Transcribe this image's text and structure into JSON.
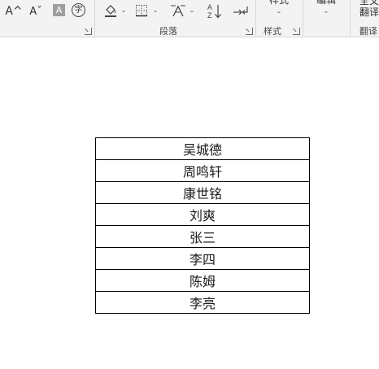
{
  "ribbon": {
    "font_grow_label": "A^",
    "font_shrink_label": "Aˇ",
    "highlight_label": "A",
    "phonetic_label": "字",
    "sort_label": "AZ↓",
    "groups": {
      "paragraph": "段落",
      "styles": "样式",
      "styles_top": "样式",
      "editing_top": "编辑",
      "translate_top": "全文",
      "translate": "翻译",
      "translate_partial": "翻译"
    }
  },
  "table": {
    "rows": [
      "吴城德",
      "周鸣轩",
      "康世铭",
      "刘爽",
      "张三",
      "李四",
      "陈姆",
      "李亮"
    ]
  }
}
